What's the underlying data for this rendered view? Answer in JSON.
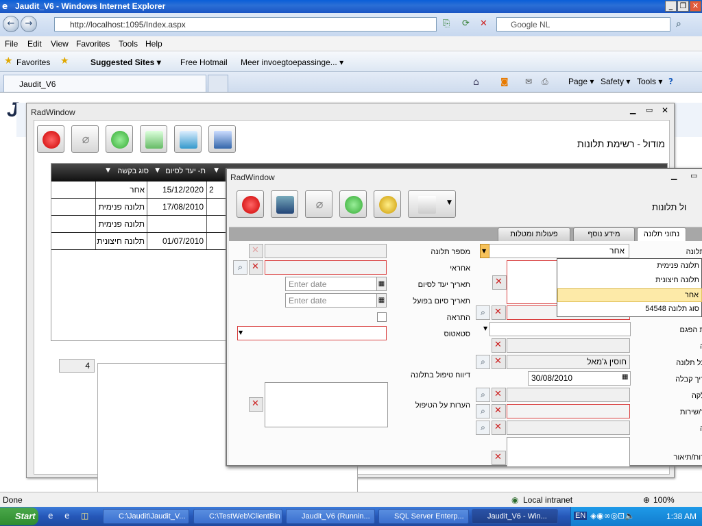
{
  "window": {
    "title": "Jaudit_V6 - Windows Internet Explorer"
  },
  "address_bar": {
    "url": "http://localhost:1095/Index.aspx",
    "search_placeholder": "Google NL"
  },
  "menu": [
    "File",
    "Edit",
    "View",
    "Favorites",
    "Tools",
    "Help"
  ],
  "favorites_bar": {
    "favorites_label": "Favorites",
    "items": [
      "Suggested Sites ▾",
      "Free Hotmail",
      "Meer invoegtoepassinge... ▾"
    ]
  },
  "tab": {
    "title": "Jaudit_V6"
  },
  "command_bar": {
    "page": "Page ▾",
    "safety": "Safety ▾",
    "tools": "Tools ▾"
  },
  "page": {
    "logo_text": "Ja"
  },
  "radwindow1": {
    "title": "RadWindow",
    "heading": "מודול - רשימת תלונות",
    "grid": {
      "columns": [
        "סוג בקשה",
        "ת- יעד לסיום"
      ],
      "rows": [
        {
          "type": "אחר",
          "due": "15/12/2020",
          "extra": "2"
        },
        {
          "type": "תלונה פנימית",
          "due": "17/08/2010",
          "extra": ""
        },
        {
          "type": "תלונה פנימית",
          "due": "",
          "extra": ""
        },
        {
          "type": "תלונה חיצונית",
          "due": "01/07/2010",
          "extra": ""
        }
      ]
    },
    "pager_value": "4"
  },
  "radwindow2": {
    "title": "RadWindow",
    "heading": "ול תלונות",
    "tabs": [
      "נתוני תלונה",
      "מידע נוסף",
      "פעולות ומטלות"
    ],
    "labels": {
      "complaint_number": "מספר תלונה",
      "responsible": "אחראי",
      "target_end": "תאריך יעד לסיום",
      "actual_end": "תאריך סיום בפועל",
      "alert": "התראה",
      "status": "סטאטוס",
      "handling_report": "דיווח טיפול בתלונה",
      "handling_notes": "הערות על הטיפול",
      "r_complaint": "תלונה",
      "r_cut1": "ת הפגם",
      "r_cut2": "ה",
      "r_cut3": "כל תלונה",
      "r_receipt_date": "ריך קבלה",
      "r_cut4": "לקה",
      "r_service": "ר/שירות",
      "r_cut5": "ה",
      "r_description": "רות/תיאור"
    },
    "type_value": "אחר",
    "person_value": "חוסין ג'מאל",
    "receipt_date": "30/08/2010",
    "date_placeholder": "Enter date",
    "dropdown_options": [
      "תלונה פנימית",
      "תלונה חיצונית",
      "אחר",
      "סוג תלונה 54548"
    ],
    "dropdown_selected": "אחר"
  },
  "status_bar": {
    "text": "Done",
    "zone": "Local intranet",
    "zoom": "100%"
  },
  "taskbar": {
    "start": "Start",
    "tasks": [
      "C:\\Jaudit\\Jaudit_V...",
      "C:\\TestWeb\\ClientBin",
      "Jaudit_V6 (Runnin...",
      "SQL Server Enterp...",
      "Jaudit_V6 - Win..."
    ],
    "lang": "EN",
    "clock": "1:38 AM"
  }
}
